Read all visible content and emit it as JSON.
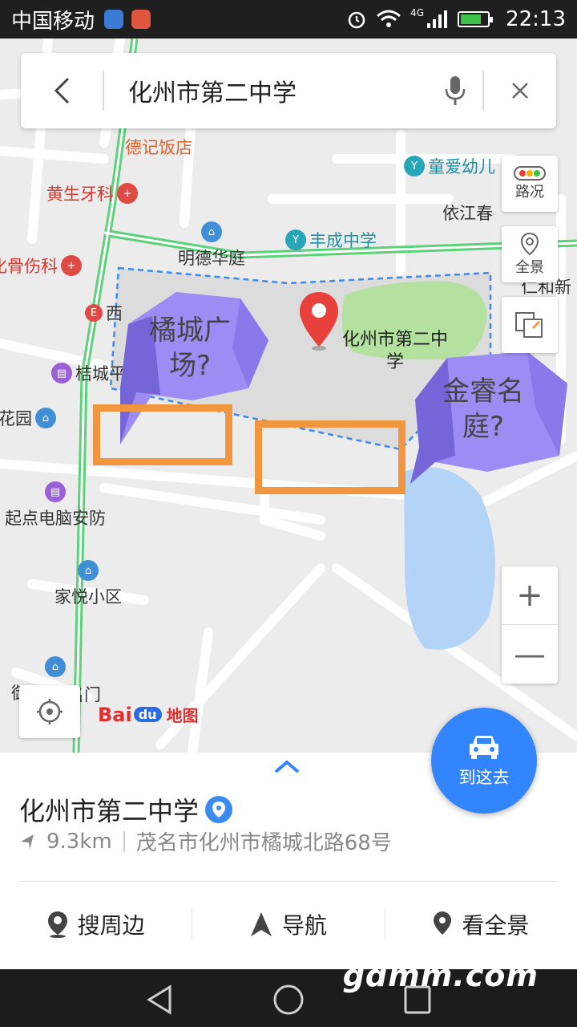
{
  "status_bar": {
    "carrier": "中国移动",
    "network": "4G",
    "time": "22:13"
  },
  "search": {
    "query": "化州市第二中学"
  },
  "map": {
    "pois": [
      {
        "id": "deji",
        "label": "德记饭店",
        "color": "#d9612b"
      },
      {
        "id": "huangsheng",
        "label": "黄生牙科",
        "color": "#d8362f"
      },
      {
        "id": "bone",
        "label": "化骨伤科",
        "color": "#d8362f"
      },
      {
        "id": "xi",
        "label": "西",
        "color": "#333333"
      },
      {
        "id": "jiecheng",
        "label": "桔城平",
        "color": "#333333"
      },
      {
        "id": "huayuan",
        "label": "花园",
        "color": "#333333"
      },
      {
        "id": "qidian",
        "label": "起点电脑安防",
        "color": "#333333"
      },
      {
        "id": "jiayue",
        "label": "家悦小区",
        "color": "#333333"
      },
      {
        "id": "yu",
        "label": "御",
        "color": "#333333"
      },
      {
        "id": "mingde",
        "label": "明德华庭",
        "color": "#333333"
      },
      {
        "id": "fengcheng",
        "label": "丰成中学",
        "color": "#1e8fa0"
      },
      {
        "id": "tongai",
        "label": "童爱幼儿",
        "color": "#1e8fa0"
      },
      {
        "id": "yijiangchun",
        "label": "依江春",
        "color": "#333333"
      },
      {
        "id": "renhexin",
        "label": "仁和新",
        "color": "#333333"
      },
      {
        "id": "mingmen",
        "label": "名门",
        "color": "#333333"
      }
    ],
    "marker_label": "化州市第二中学",
    "annotations": [
      {
        "id": "juchengguangchang",
        "text": "橘城广场?"
      },
      {
        "id": "jinruimingting",
        "text": "金睿名庭?"
      }
    ],
    "logo": {
      "bai": "Bai",
      "du": "du",
      "ditu": "地图"
    }
  },
  "controls": {
    "traffic_label": "路况",
    "panorama_label": "全景",
    "zoom_in": "+",
    "zoom_out": "—"
  },
  "place": {
    "name": "化州市第二中学",
    "distance": "9.3km",
    "address": "茂名市化州市橘城北路68号",
    "go_label": "到这去"
  },
  "actions": [
    {
      "label": "搜周边"
    },
    {
      "label": "导航"
    },
    {
      "label": "看全景"
    }
  ],
  "watermark": "gdmm.com",
  "colors": {
    "accent": "#3385ff",
    "marker_red": "#e8403a",
    "road_green": "#5cd17a",
    "annotation_purple": "#9c8cf3",
    "highlight_orange": "#f2953f",
    "water": "#b3d4f7",
    "park": "#b4e0a0"
  }
}
